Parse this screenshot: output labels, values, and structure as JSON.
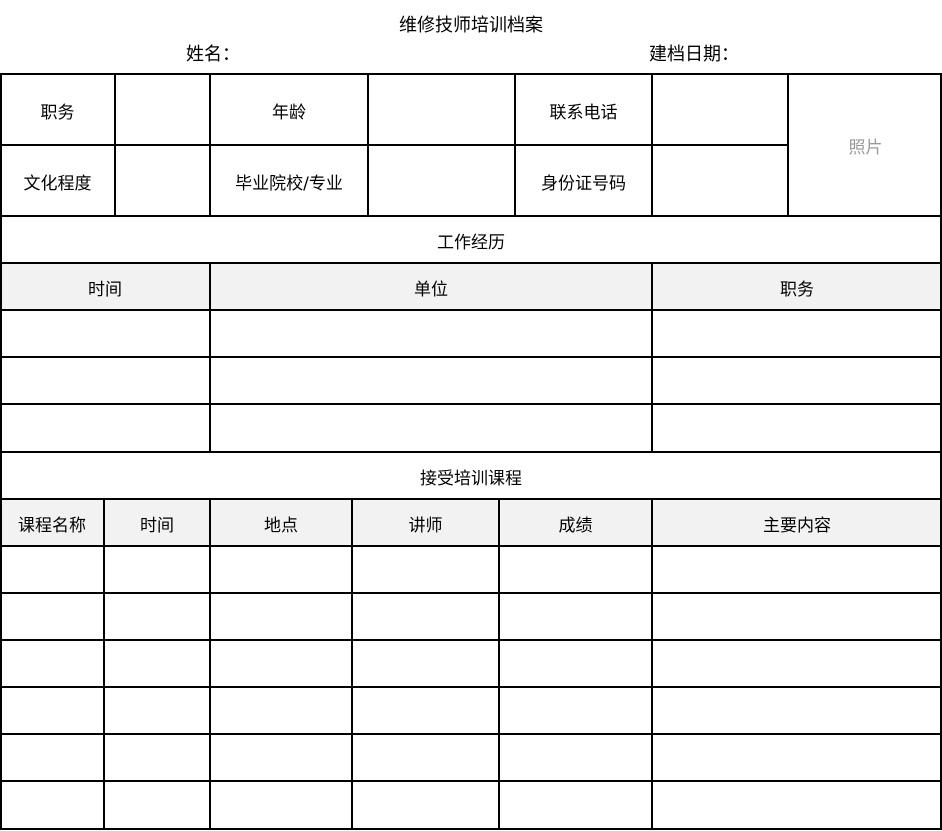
{
  "title": "维修技师培训档案",
  "header": {
    "name_label": "姓名：",
    "date_label": "建档日期："
  },
  "info": {
    "position_label": "职务",
    "age_label": "年龄",
    "phone_label": "联系电话",
    "education_label": "文化程度",
    "school_label": "毕业院校/专业",
    "id_label": "身份证号码",
    "photo_label": "照片"
  },
  "work": {
    "section_title": "工作经历",
    "columns": [
      "时间",
      "单位",
      "职务"
    ]
  },
  "training": {
    "section_title": "接受培训课程",
    "columns": [
      "课程名称",
      "时间",
      "地点",
      "讲师",
      "成绩",
      "主要内容"
    ]
  }
}
